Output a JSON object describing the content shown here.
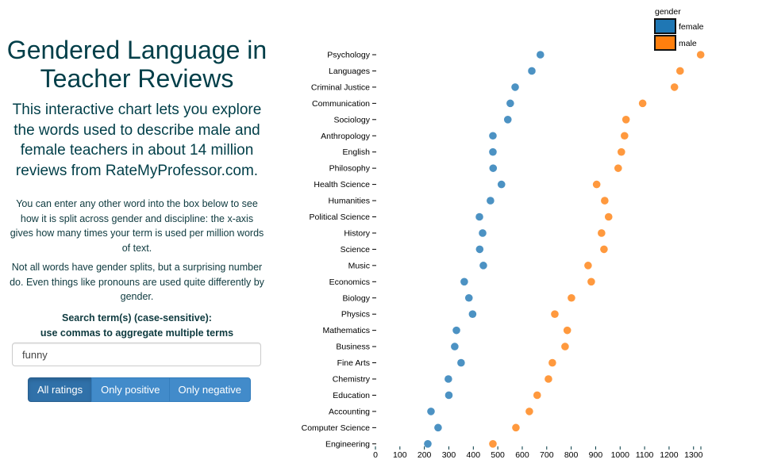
{
  "left_panel": {
    "title": "Gendered Language in Teacher Reviews",
    "intro": "This interactive chart lets you explore the words used to describe male and female teachers in about 14 million reviews from RateMyProfessor.com.",
    "paragraph_1": "You can enter any other word into the box below to see how it is split across gender and discipline: the x-axis gives how many times your term is used per million words of text.",
    "paragraph_2": "Not all words have gender splits, but a surprising number do. Even things like pronouns are used quite differently by gender.",
    "search_label_line1": "Search term(s) (case-sensitive):",
    "search_label_line2": "use commas to aggregate multiple terms",
    "search_value": "funny",
    "buttons": [
      {
        "label": "All ratings",
        "active": true
      },
      {
        "label": "Only positive",
        "active": false
      },
      {
        "label": "Only negative",
        "active": false
      }
    ]
  },
  "chart_data": {
    "type": "scatter",
    "title": "",
    "xlabel": "",
    "ylabel": "",
    "xlim": [
      0,
      1330
    ],
    "x_ticks": [
      0,
      100,
      200,
      300,
      400,
      500,
      600,
      700,
      800,
      900,
      1000,
      1100,
      1200,
      1300
    ],
    "grid": false,
    "legend": {
      "title": "gender",
      "position": "top-right",
      "entries": [
        {
          "name": "female",
          "color": "#1f77b4"
        },
        {
          "name": "male",
          "color": "#ff7f0e"
        }
      ]
    },
    "categories": [
      "Psychology",
      "Languages",
      "Criminal Justice",
      "Communication",
      "Sociology",
      "Anthropology",
      "English",
      "Philosophy",
      "Health Science",
      "Humanities",
      "Political Science",
      "History",
      "Science",
      "Music",
      "Economics",
      "Biology",
      "Physics",
      "Mathematics",
      "Business",
      "Fine Arts",
      "Chemistry",
      "Education",
      "Accounting",
      "Computer Science",
      "Engineering"
    ],
    "series": [
      {
        "name": "female",
        "color": "#1f77b4",
        "values": [
          674,
          639,
          571,
          551,
          541,
          480,
          480,
          481,
          515,
          470,
          425,
          438,
          426,
          441,
          363,
          382,
          397,
          331,
          324,
          350,
          298,
          300,
          227,
          256,
          214
        ]
      },
      {
        "name": "male",
        "color": "#ff7f0e",
        "values": [
          1329,
          1245,
          1222,
          1092,
          1024,
          1018,
          1005,
          992,
          904,
          937,
          953,
          924,
          934,
          869,
          882,
          801,
          733,
          784,
          775,
          723,
          707,
          661,
          629,
          574,
          480
        ]
      }
    ]
  }
}
